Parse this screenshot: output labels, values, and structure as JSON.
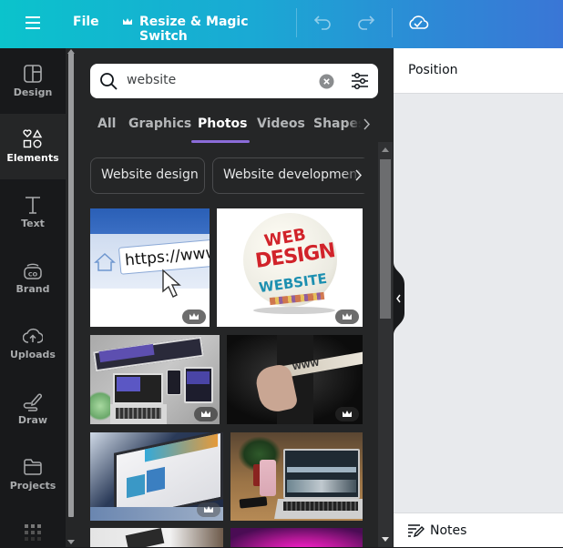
{
  "topbar": {
    "menu_icon": "hamburger-icon",
    "file_label": "File",
    "resize_label": "Resize & Magic Switch",
    "resize_icon": "crown-icon",
    "undo_icon": "undo-icon",
    "redo_icon": "redo-icon",
    "cloud_icon": "cloud-check-icon"
  },
  "sidebar": {
    "items": [
      {
        "label": "Design",
        "icon": "layout-icon",
        "active": false
      },
      {
        "label": "Elements",
        "icon": "shapes-icon",
        "active": true
      },
      {
        "label": "Text",
        "icon": "text-icon",
        "active": false
      },
      {
        "label": "Brand",
        "icon": "brand-icon",
        "active": false
      },
      {
        "label": "Uploads",
        "icon": "cloud-upload-icon",
        "active": false
      },
      {
        "label": "Draw",
        "icon": "draw-icon",
        "active": false
      },
      {
        "label": "Projects",
        "icon": "folder-icon",
        "active": false
      }
    ],
    "more_icon": "apps-grid-icon"
  },
  "panel": {
    "search": {
      "value": "website",
      "clear_icon": "clear-icon",
      "filter_icon": "filter-icon"
    },
    "tabs": [
      {
        "label": "All",
        "active": false
      },
      {
        "label": "Graphics",
        "active": false
      },
      {
        "label": "Photos",
        "active": true
      },
      {
        "label": "Videos",
        "active": false
      },
      {
        "label": "Shapes",
        "active": false
      }
    ],
    "chips": [
      "Website design",
      "Website development"
    ],
    "results": [
      {
        "description": "Browser address bar https://www with cursor",
        "caption": "https://www",
        "premium": true
      },
      {
        "description": "Sphere word cloud Web Design Website",
        "caption_lines": [
          "WEB",
          "DESIGN",
          "WEBSITE"
        ],
        "premium": true
      },
      {
        "description": "Responsive website mockup on devices",
        "premium": true
      },
      {
        "description": "Hand touching www search bar",
        "caption": "WWW",
        "premium": true
      },
      {
        "description": "Laptop showing website",
        "premium": true
      },
      {
        "description": "Laptop on desk with coffee cup and phone",
        "premium": false
      },
      {
        "description": "Laptop on white desk",
        "premium": false
      },
      {
        "description": "Magenta gradient background",
        "premium": false
      }
    ]
  },
  "right_panel": {
    "title": "Position",
    "notes_label": "Notes",
    "notes_icon": "notes-icon",
    "collapse_icon": "chevron-left-icon"
  }
}
